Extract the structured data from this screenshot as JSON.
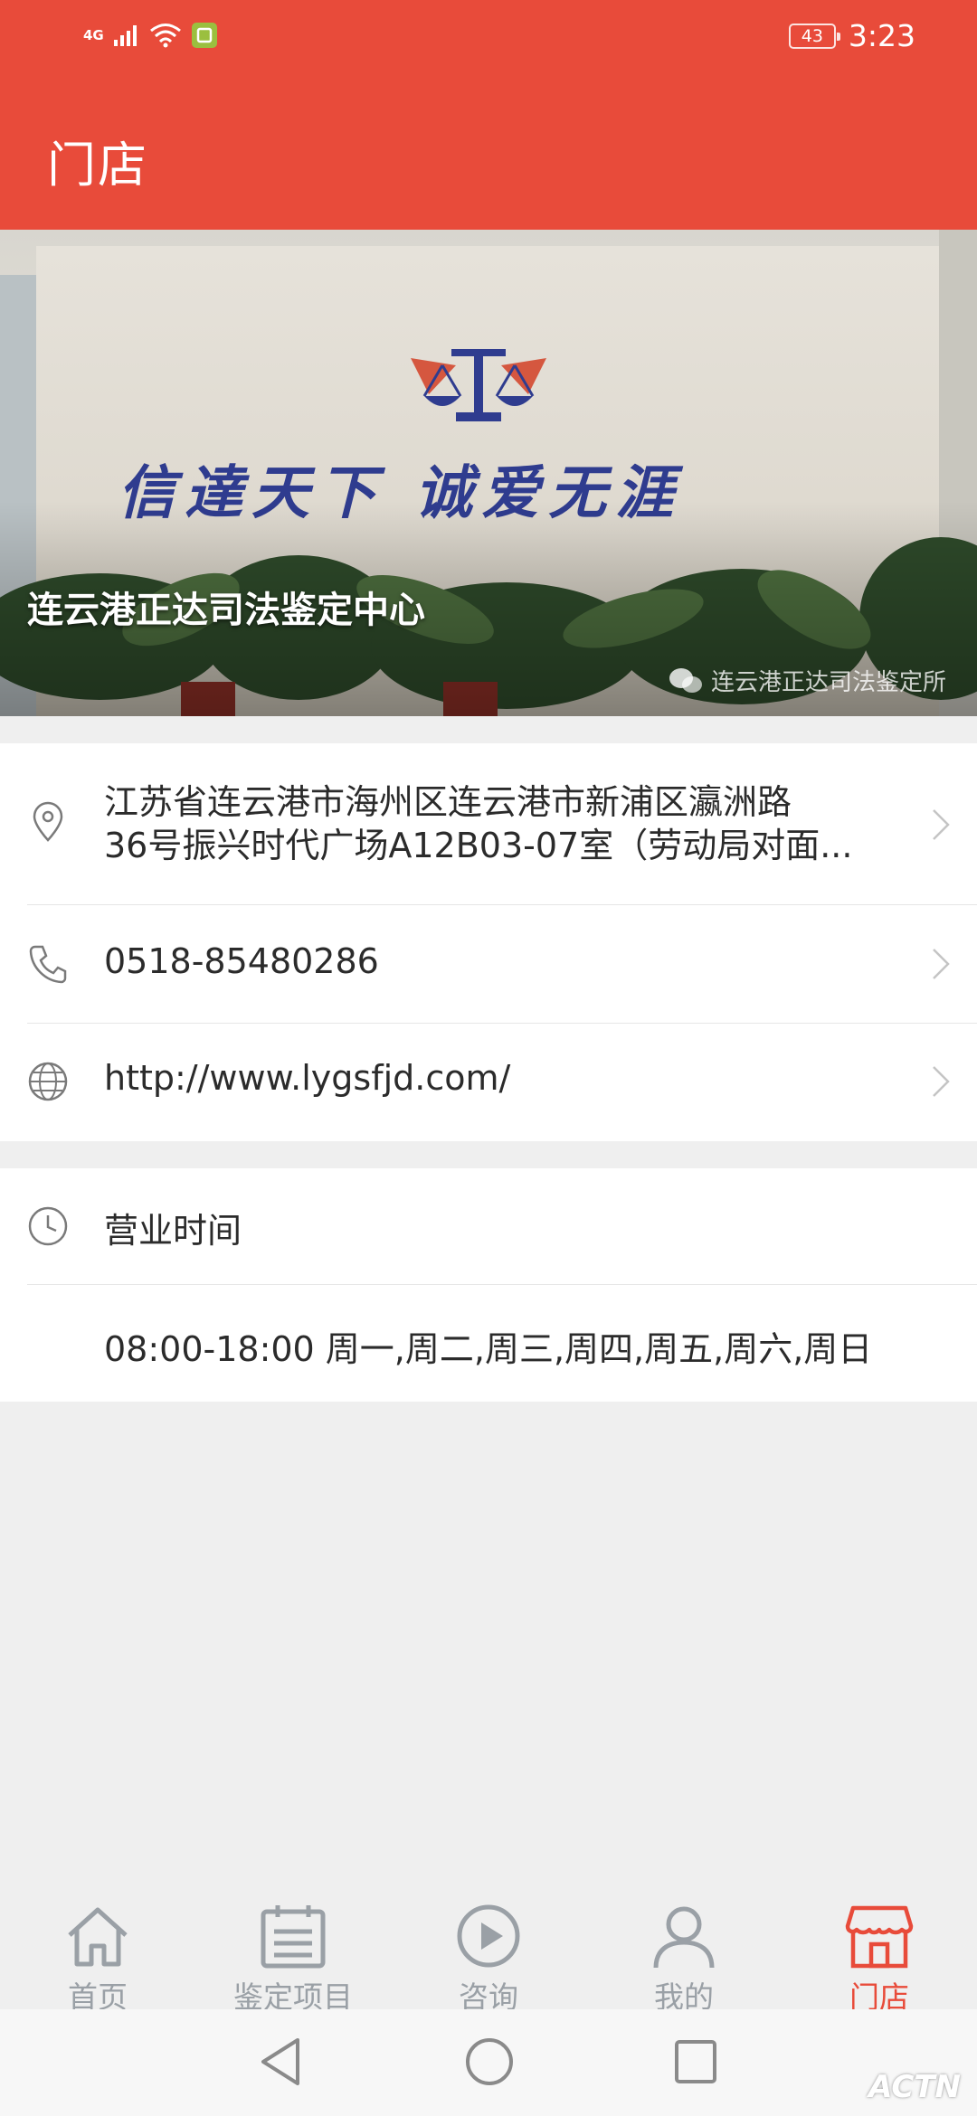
{
  "status_bar": {
    "network": "4G",
    "battery": "43",
    "time": "3:23"
  },
  "header": {
    "title": "门店"
  },
  "banner": {
    "store_name": "连云港正达司法鉴定中心",
    "slogan": "信達天下  诚爱无涯",
    "watermark": "连云港正达司法鉴定所"
  },
  "contact": {
    "address_line1": "江苏省连云港市海州区连云港市新浦区瀛洲路",
    "address_line2": "36号振兴时代广场A12B03-07室（劳动局对面...",
    "phone": "0518-85480286",
    "website": "http://www.lygsfjd.com/"
  },
  "hours": {
    "label": "营业时间",
    "value": "08:00-18:00 周一,周二,周三,周四,周五,周六,周日"
  },
  "tabbar": {
    "items": [
      {
        "label": "首页",
        "icon": "home-icon"
      },
      {
        "label": "鉴定项目",
        "icon": "calendar-icon"
      },
      {
        "label": "咨询",
        "icon": "play-icon"
      },
      {
        "label": "我的",
        "icon": "user-icon"
      },
      {
        "label": "门店",
        "icon": "store-icon",
        "active": true
      }
    ]
  },
  "corner_logo": "ACTN",
  "colors": {
    "brand": "#e84b3a",
    "inactive": "#9aa0a6"
  }
}
